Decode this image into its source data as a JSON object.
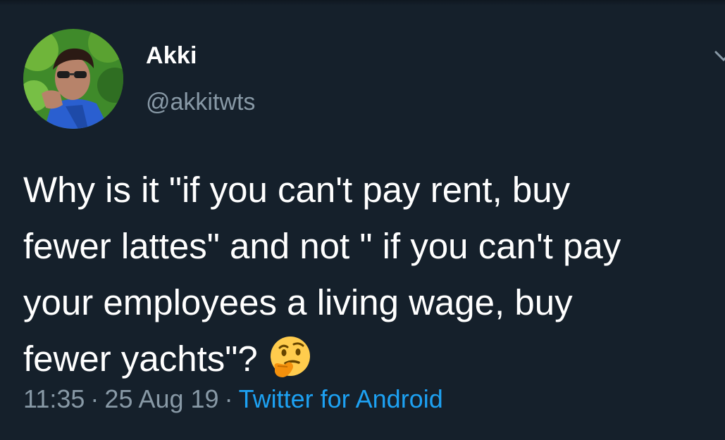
{
  "tweet": {
    "display_name": "Akki",
    "handle": "@akkitwts",
    "text_lines": [
      "Why is it \"if you can't pay rent, buy",
      "fewer lattes\" and not \" if you can't pay",
      "your employees a living wage, buy",
      "fewer yachts\"?"
    ],
    "emoji": "thinking-face",
    "time": "11:35",
    "separator": "·",
    "date": "25 Aug 19",
    "source": "Twitter for Android"
  },
  "colors": {
    "background": "#15202b",
    "secondary_text": "#8899a6",
    "link": "#1da1f2"
  }
}
